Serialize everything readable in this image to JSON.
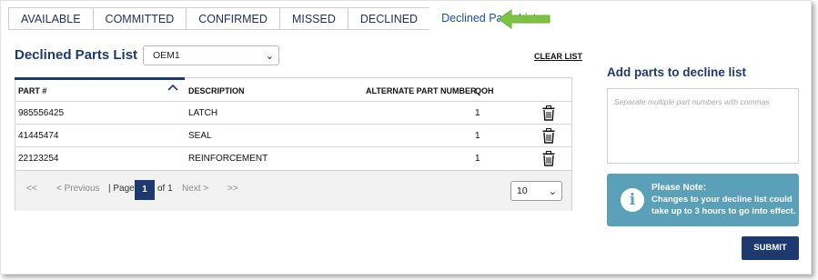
{
  "tabs": [
    {
      "label": "AVAILABLE"
    },
    {
      "label": "COMMITTED"
    },
    {
      "label": "CONFIRMED"
    },
    {
      "label": "MISSED"
    },
    {
      "label": "DECLINED"
    },
    {
      "label": "Declined Parts List",
      "active": true
    }
  ],
  "page_title": "Declined Parts List",
  "oem_select": {
    "value": "OEM1"
  },
  "clear_list": "CLEAR LIST",
  "table": {
    "headers": {
      "part": "PART #",
      "description": "DESCRIPTION",
      "alternate": "ALTERNATE PART NUMBER",
      "qoh": "QOH"
    },
    "rows": [
      {
        "part": "985556425",
        "description": "LATCH",
        "alternate": "",
        "qoh": "1"
      },
      {
        "part": "41445474",
        "description": "SEAL",
        "alternate": "",
        "qoh": "1"
      },
      {
        "part": "22123254",
        "description": "REINFORCEMENT",
        "alternate": "",
        "qoh": "1"
      }
    ]
  },
  "pager": {
    "first": "<<",
    "previous": "< Previous",
    "page_label": "| Page",
    "current_page": "1",
    "of_label": "of 1",
    "next": "Next >",
    "last": ">>",
    "page_size": "10"
  },
  "add_panel": {
    "title": "Add parts to decline list",
    "placeholder": "Separate multiple part numbers with commas",
    "note_title": "Please Note:",
    "note_text": "Changes to your decline list could take up to 3 hours to go into effect.",
    "submit": "SUBMIT"
  },
  "colors": {
    "brand": "#1d3a6e",
    "note": "#5aa0b8",
    "arrow": "#7dc242"
  },
  "icons": {
    "delete": "trash-icon",
    "sort": "caret-up-icon",
    "info": "info-icon",
    "annotation": "green-arrow-icon"
  }
}
